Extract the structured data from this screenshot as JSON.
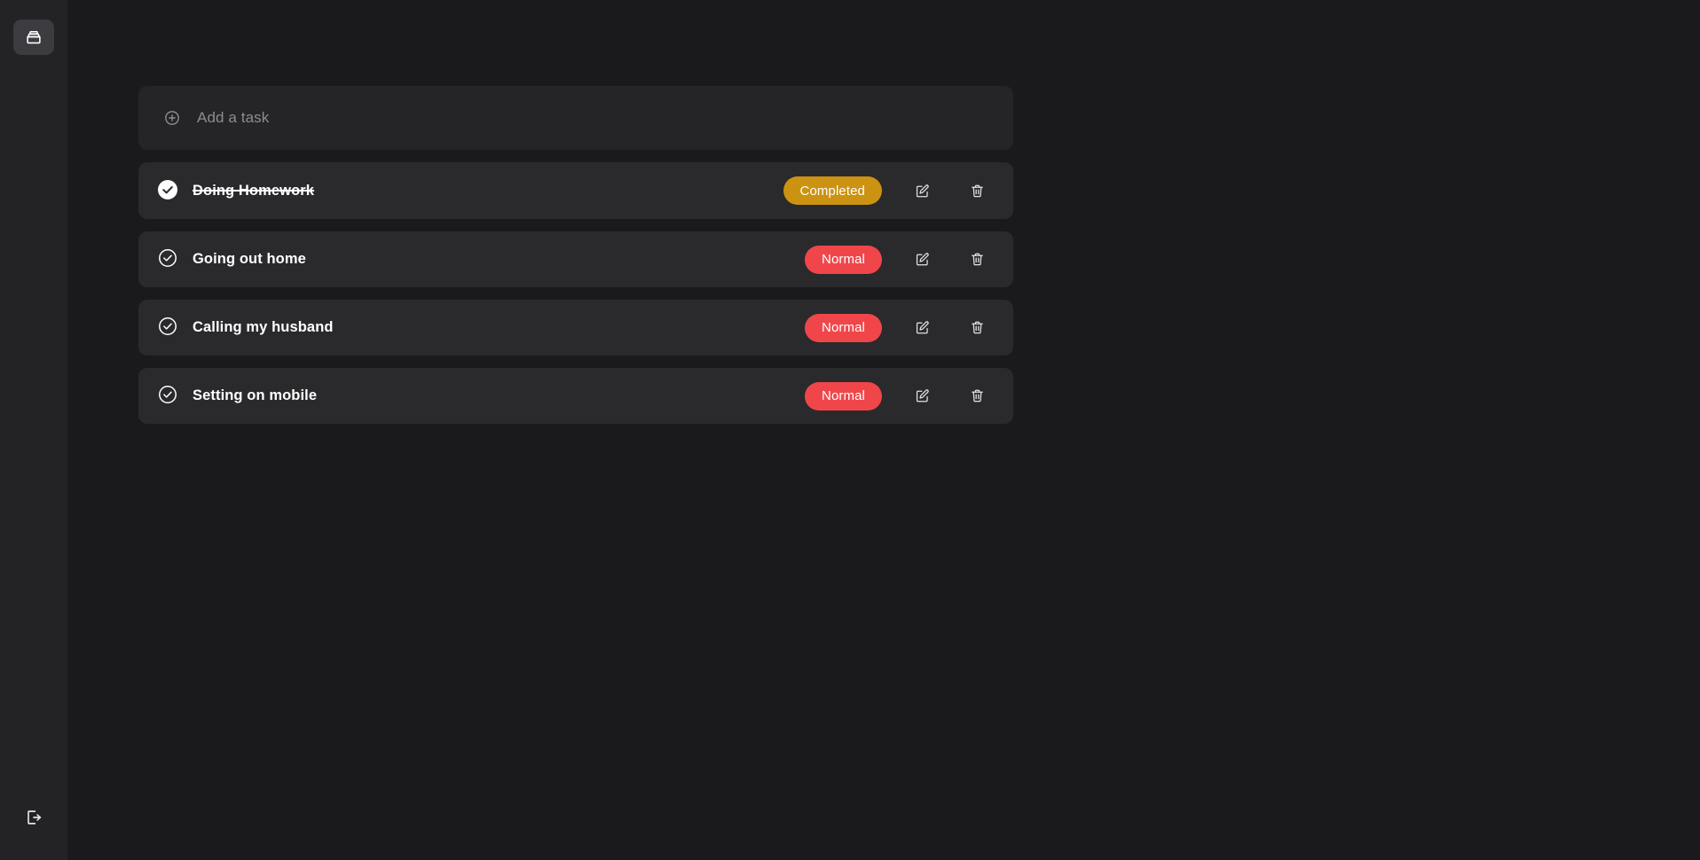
{
  "app": {
    "title": "Task Manager",
    "theme": "dark",
    "colors": {
      "background": "#1a1a1c",
      "sidebar": "#232325",
      "card": "#2a2a2c",
      "add_card": "#252527",
      "badge_completed": "#cc9212",
      "badge_normal": "#f0464a",
      "text": "#ffffff",
      "placeholder": "#8a8d93",
      "sidebar_active": "#3b3b40"
    }
  },
  "sidebar": {
    "top_items": [
      {
        "name": "tasks",
        "icon": "inbox-icon",
        "label": "Tasks",
        "active": true
      }
    ],
    "bottom_items": [
      {
        "name": "logout",
        "icon": "logout-icon",
        "label": "Logout",
        "active": false
      }
    ]
  },
  "add_task": {
    "icon": "plus-circle-icon",
    "placeholder": "Add a task",
    "value": ""
  },
  "row_actions": {
    "edit_icon": "edit-pencil-square-icon",
    "edit_label": "Edit task",
    "delete_icon": "trash-icon",
    "delete_label": "Delete task"
  },
  "tasks": [
    {
      "title": "Doing Homework",
      "completed": true,
      "status_label": "Completed",
      "status_type": "completed",
      "check_icon": "check-circle-filled-icon"
    },
    {
      "title": "Going out home",
      "completed": false,
      "status_label": "Normal",
      "status_type": "normal",
      "check_icon": "check-circle-outline-icon"
    },
    {
      "title": "Calling my husband",
      "completed": false,
      "status_label": "Normal",
      "status_type": "normal",
      "check_icon": "check-circle-outline-icon"
    },
    {
      "title": "Setting on mobile",
      "completed": false,
      "status_label": "Normal",
      "status_type": "normal",
      "check_icon": "check-circle-outline-icon"
    }
  ]
}
